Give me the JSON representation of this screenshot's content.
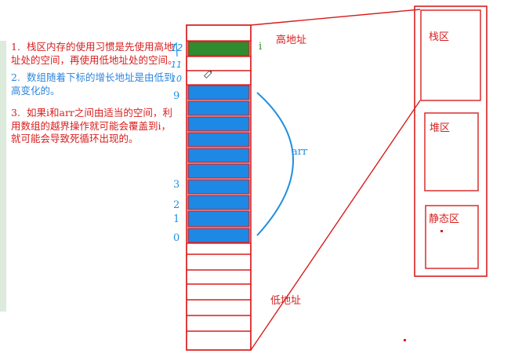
{
  "notes": [
    {
      "num": "1.",
      "text": "栈区内存的使用习惯是先使用高地址处的空间，再使用低地址处的空间。",
      "color": "#d81e1e"
    },
    {
      "num": "2.",
      "text": "数组随着下标的增长地址是由低到高变化的。",
      "color": "#2e86de"
    },
    {
      "num": "3.",
      "text": "如果i和arr之间由适当的空间，利用数组的越界操作就可能会覆盖到i，就可能会导致死循环出现的。",
      "color": "#d81e1e"
    }
  ],
  "labels": {
    "high_addr": "高地址",
    "low_addr": "低地址",
    "var_i": "i",
    "arr": "arr",
    "stack": "栈区",
    "heap": "堆区",
    "static": "静态区"
  },
  "indices": {
    "left_red": [
      "12",
      "11",
      "10"
    ],
    "left_blue": [
      "9",
      "3",
      "2",
      "1",
      "0"
    ]
  },
  "colors": {
    "red": "#d81e1e",
    "blue_fill": "#1e88e5",
    "green_fill": "#2e8b2e",
    "strip": "#dcebdc"
  }
}
